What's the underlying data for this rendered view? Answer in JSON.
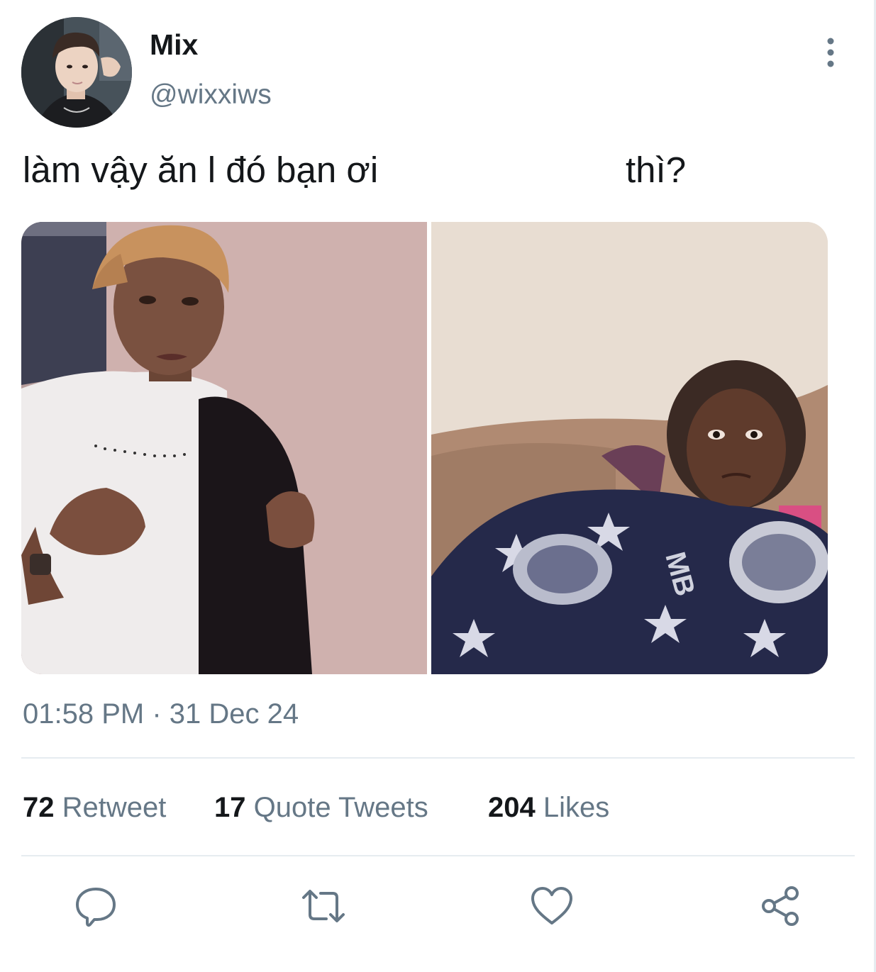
{
  "tweet": {
    "author": {
      "display_name": "Mix",
      "handle": "@wixxiws"
    },
    "text_part1": "làm vậy ăn l đó bạn ơi",
    "text_part2": "thì?",
    "media": {
      "panels": [
        "crying-woman-photo",
        "woman-on-couch-photo"
      ]
    },
    "timestamp": "01:58 PM · 31 Dec 24"
  },
  "stats": {
    "retweets": {
      "count": "72",
      "label": "Retweet"
    },
    "quotes": {
      "count": "17",
      "label": "Quote Tweets"
    },
    "likes": {
      "count": "204",
      "label": "Likes"
    }
  },
  "actions": [
    "reply-icon",
    "retweet-icon",
    "like-icon",
    "share-icon"
  ],
  "colors": {
    "text_primary": "#14171a",
    "text_secondary": "#657786",
    "divider": "#e6ecf0",
    "icon": "#657786"
  }
}
